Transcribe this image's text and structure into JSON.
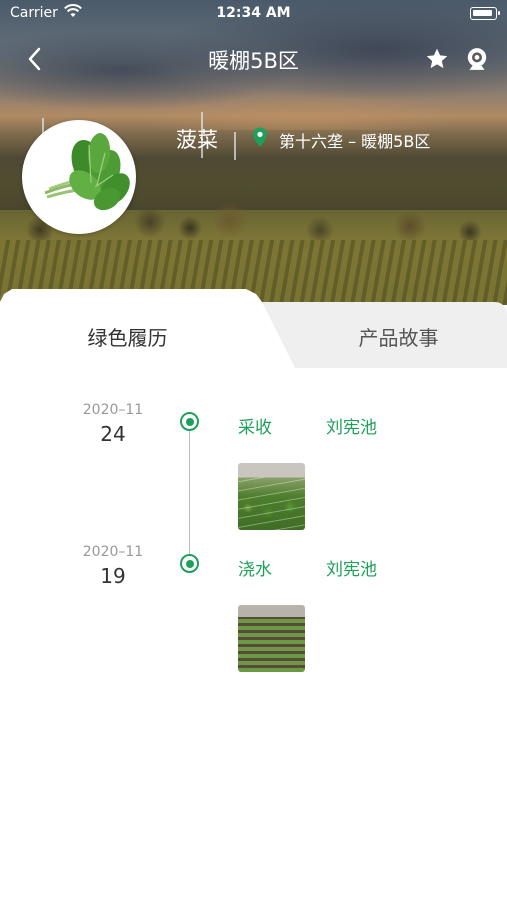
{
  "status_bar": {
    "carrier": "Carrier",
    "time": "12:34 AM"
  },
  "nav": {
    "title": "暖棚5B区"
  },
  "product": {
    "name": "菠菜",
    "location": "第十六垄 – 暖棚5B区"
  },
  "tabs": [
    {
      "label": "绿色履历",
      "active": true
    },
    {
      "label": "产品故事",
      "active": false
    }
  ],
  "timeline": [
    {
      "year_month": "2020–11",
      "day": "24",
      "action": "采收",
      "person": "刘宪池"
    },
    {
      "year_month": "2020–11",
      "day": "19",
      "action": "浇水",
      "person": "刘宪池"
    }
  ],
  "colors": {
    "accent": "#1ea05a",
    "text_dark": "#333333",
    "text_muted": "#999999",
    "tab_inactive_bg": "#efefef"
  },
  "icons": {
    "back": "chevron-left-icon",
    "favorite": "star-icon",
    "camera": "webcam-icon",
    "location": "map-pin-icon"
  }
}
